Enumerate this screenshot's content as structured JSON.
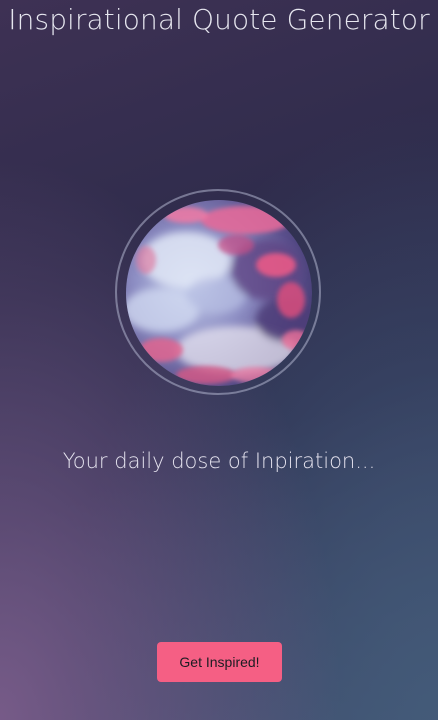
{
  "header": {
    "title": "Inspirational Quote Generator"
  },
  "hero": {
    "image_icon": "sunset-clouds-image"
  },
  "quote": {
    "text": "Your daily dose of Inpiration..."
  },
  "actions": {
    "inspire_label": "Get Inspired!"
  },
  "colors": {
    "button": "#f55f84",
    "title_text": "#e6e6ef",
    "background_top": "#3e3154",
    "background_bottom_left": "#7a5c8a",
    "background_bottom_right": "#445c7a"
  }
}
